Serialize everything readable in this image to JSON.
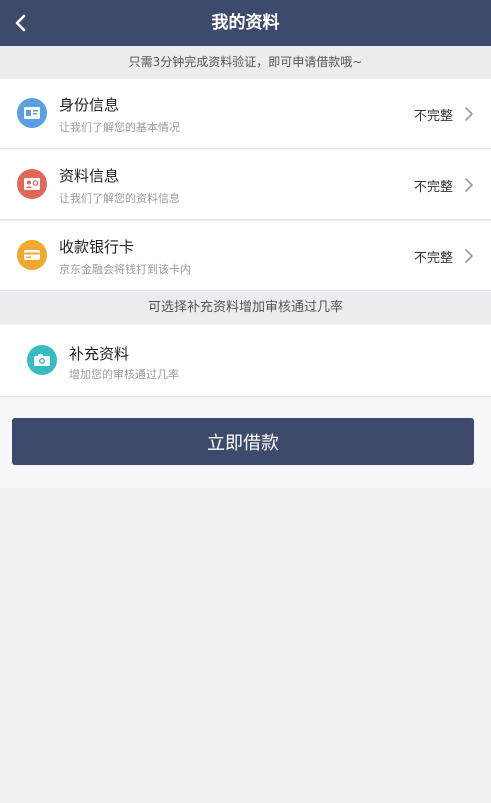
{
  "header": {
    "title": "我的资料"
  },
  "notice": "只需3分钟完成资料验证，即可申请借款哦~",
  "items": [
    {
      "name": "身份信息",
      "desc": "让我们了解您的基本情况",
      "status": "不完整",
      "icon": "id-card-icon",
      "color": "#5aa0e0"
    },
    {
      "name": "资料信息",
      "desc": "让我们了解您的资料信息",
      "status": "不完整",
      "icon": "profile-card-icon",
      "color": "#e0665a"
    },
    {
      "name": "收款银行卡",
      "desc": "京东金融会将钱打到该卡内",
      "status": "不完整",
      "icon": "bank-card-icon",
      "color": "#f0a830"
    }
  ],
  "section_label": "可选择补充资料增加审核通过几率",
  "supplement": {
    "name": "补充资料",
    "desc": "增加您的审核通过几率",
    "icon": "camera-icon",
    "color": "#35bcc4"
  },
  "submit_label": "立即借款",
  "colors": {
    "header": "#3d4a6b",
    "button": "#3d4a6b",
    "background": "#efeff4"
  }
}
